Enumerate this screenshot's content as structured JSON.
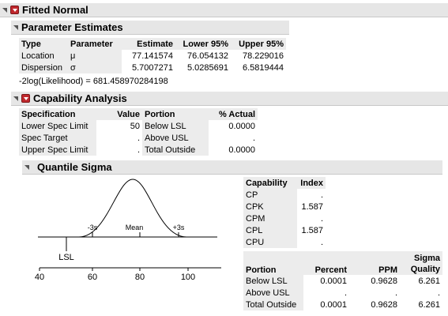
{
  "fitted_normal": {
    "title": "Fitted Normal"
  },
  "parameter_estimates": {
    "title": "Parameter Estimates",
    "headers": [
      "Type",
      "Parameter",
      "Estimate",
      "Lower 95%",
      "Upper 95%"
    ],
    "rows": [
      [
        "Location",
        "μ",
        "77.141574",
        "76.054132",
        "78.229016"
      ],
      [
        "Dispersion",
        "σ",
        "5.7007271",
        "5.0285691",
        "6.5819444"
      ]
    ],
    "loglik": "-2log(Likelihood) = 681.458970284198"
  },
  "capability": {
    "title": "Capability Analysis",
    "headers": [
      "Specification",
      "Value",
      "Portion",
      "% Actual"
    ],
    "rows": [
      [
        "Lower Spec Limit",
        "50",
        "Below LSL",
        "0.0000"
      ],
      [
        "Spec Target",
        ".",
        "Above USL",
        "."
      ],
      [
        "Upper Spec Limit",
        ".",
        "Total Outside",
        "0.0000"
      ]
    ]
  },
  "quantile_sigma": {
    "title": "Quantile Sigma",
    "plot": {
      "labels": {
        "minus3": "-3s",
        "mean": "Mean",
        "plus3": "+3s",
        "lsl": "LSL"
      },
      "x_ticks": [
        "40",
        "60",
        "80",
        "100"
      ]
    },
    "index_table": {
      "headers": [
        "Capability",
        "Index"
      ],
      "rows": [
        [
          "CP",
          "."
        ],
        [
          "CPK",
          "1.587"
        ],
        [
          "CPM",
          "."
        ],
        [
          "CPL",
          "1.587"
        ],
        [
          "CPU",
          "."
        ]
      ]
    },
    "portion_table": {
      "headers": [
        "Portion",
        "Percent",
        "PPM",
        "Sigma Quality"
      ],
      "header_lines": {
        "sigma1": "Sigma",
        "sigma2": "Quality"
      },
      "rows": [
        [
          "Below LSL",
          "0.0001",
          "0.9628",
          "6.261"
        ],
        [
          "Above USL",
          ".",
          ".",
          "."
        ],
        [
          "Total Outside",
          "0.0001",
          "0.9628",
          "6.261"
        ]
      ]
    }
  }
}
